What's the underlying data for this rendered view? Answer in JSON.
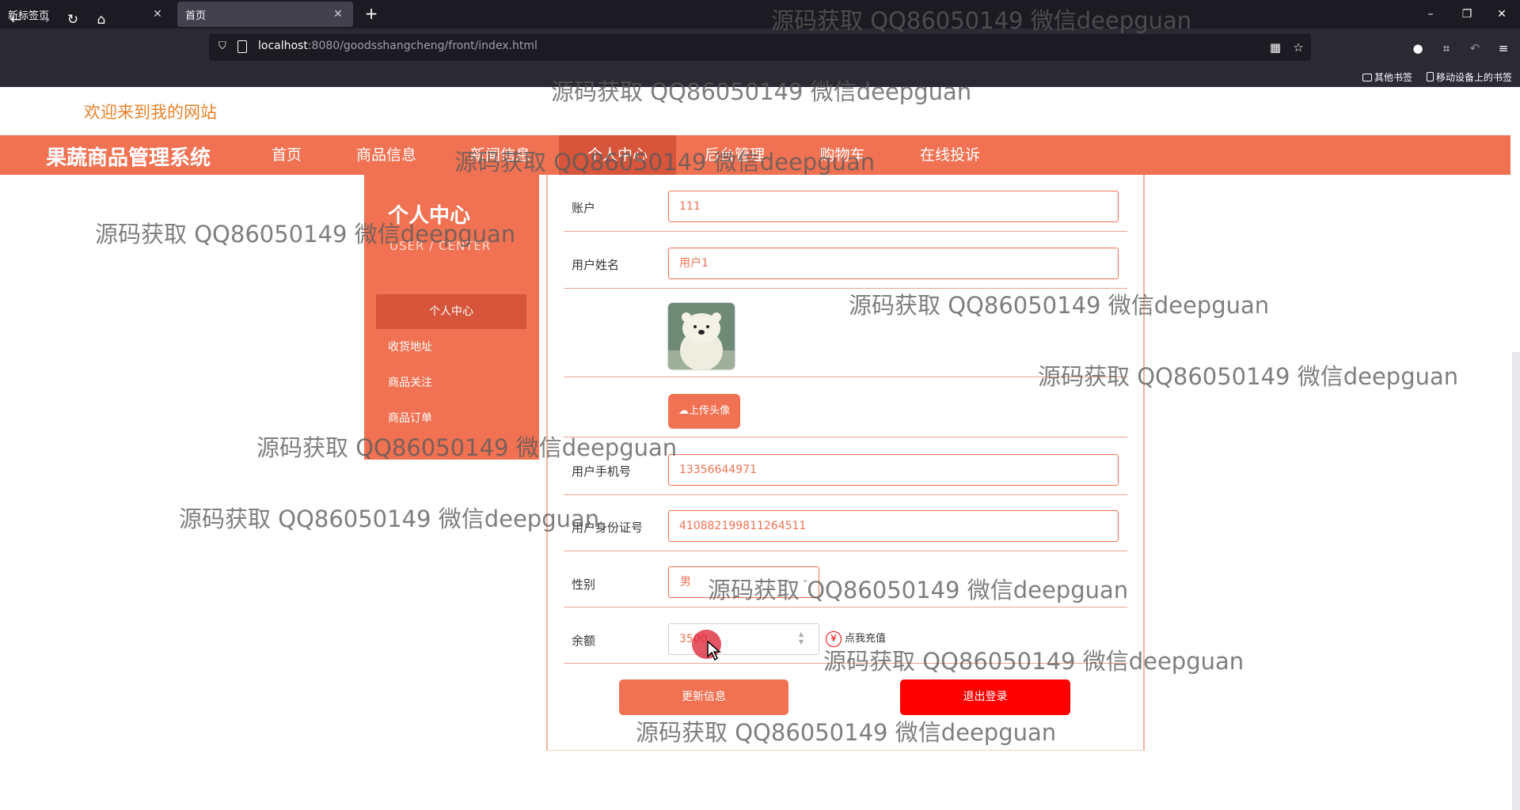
{
  "browser": {
    "tabs": [
      {
        "title": "新标签页"
      },
      {
        "title": "首页"
      }
    ],
    "url_host": "localhost",
    "url_rest": ":8080/goodsshangcheng/front/index.html",
    "bookmarks": [
      "其他书签",
      "移动设备上的书签"
    ]
  },
  "site": {
    "welcome": "欢迎来到我的网站",
    "brand": "果蔬商品管理系统",
    "nav": [
      "首页",
      "商品信息",
      "新闻信息",
      "个人中心",
      "后台管理",
      "购物车",
      "在线投诉"
    ],
    "active_nav": "个人中心"
  },
  "sidebar": {
    "title": "个人中心",
    "subtitle": "USER / CENTER",
    "items": [
      "个人中心",
      "收货地址",
      "商品关注",
      "商品订单"
    ]
  },
  "form": {
    "account_label": "账户",
    "account_value": "111",
    "name_label": "用户姓名",
    "name_value": "用户1",
    "upload_label": "上传头像",
    "phone_label": "用户手机号",
    "phone_value": "13356644971",
    "idcard_label": "用户身份证号",
    "idcard_value": "410882199811264511",
    "gender_label": "性别",
    "gender_value": "男",
    "balance_label": "余额",
    "balance_value": "3500",
    "recharge_label": "点我充值",
    "update_button": "更新信息",
    "logout_button": "退出登录"
  },
  "watermark": "源码获取 QQ86050149 微信deepguan",
  "colors": {
    "primary": "#f07252",
    "primary_dark": "#d6553b",
    "danger": "#ff0000",
    "welcome": "#e8822a"
  }
}
